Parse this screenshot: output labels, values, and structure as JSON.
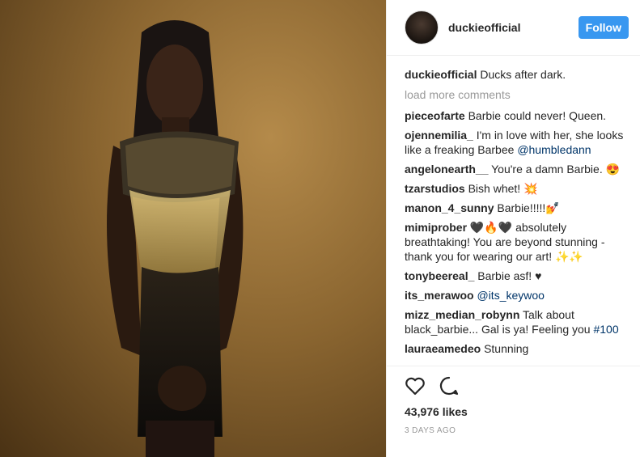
{
  "post": {
    "username": "duckieofficial",
    "follow_label": "Follow",
    "caption_user": "duckieofficial",
    "caption_text": "Ducks after dark.",
    "load_more": "load more comments",
    "comments": [
      {
        "user": "pieceofarte",
        "text": "Barbie could never! Queen."
      },
      {
        "user": "ojennemilia_",
        "text": "I'm in love with her, she looks like a freaking Barbee",
        "tag": "@humbledann"
      },
      {
        "user": "angelonearth__",
        "text": "You're a damn Barbie. 😍"
      },
      {
        "user": "tzarstudios",
        "text": "Bish whet! 💥"
      },
      {
        "user": "manon_4_sunny",
        "text": "Barbie!!!!!💅"
      },
      {
        "user": "mimiprober",
        "text": "🖤🔥🖤 absolutely breathtaking! You are beyond stunning - thank you for wearing our art! ✨✨"
      },
      {
        "user": "tonybeereal_",
        "text": "Barbie asf! ♥"
      },
      {
        "user": "its_merawoo",
        "text": "",
        "tag": "@its_keywoo"
      },
      {
        "user": "mizz_median_robynn",
        "text": "Talk about black_barbie... Gal is ya! Feeling you",
        "tag": "#100"
      },
      {
        "user": "lauraeamedeo",
        "text": "Stunning"
      }
    ],
    "likes": "43,976 likes",
    "date": "3 DAYS AGO"
  },
  "icons": {
    "like": "heart-icon",
    "comment": "comment-icon"
  },
  "colors": {
    "accent": "#3897f0",
    "tag": "#003569"
  }
}
